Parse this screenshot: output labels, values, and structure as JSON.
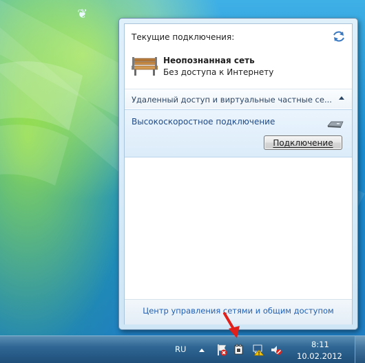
{
  "flyout": {
    "current_connections_label": "Текущие подключения:",
    "network_name": "Неопознанная сеть",
    "network_status": "Без доступа к Интернету",
    "section_title": "Удаленный доступ и виртуальные частные се...",
    "connection_name": "Высокоскоростное подключение",
    "connect_button_label": "Подключение",
    "network_center_link": "Центр управления сетями и общим доступом"
  },
  "taskbar": {
    "language": "RU",
    "time": "8:11",
    "date": "10.02.2012"
  },
  "icons": {
    "refresh": "refresh-icon",
    "network": "bench-network-icon",
    "modem": "modem-icon",
    "tray": [
      "action-center-error-icon",
      "network-tray-icon",
      "network-warning-icon",
      "volume-muted-icon"
    ]
  },
  "colors": {
    "link_blue": "#1f5fb3",
    "selected_item_bg": "#dcecf9",
    "arrow_red": "#e0201b"
  }
}
